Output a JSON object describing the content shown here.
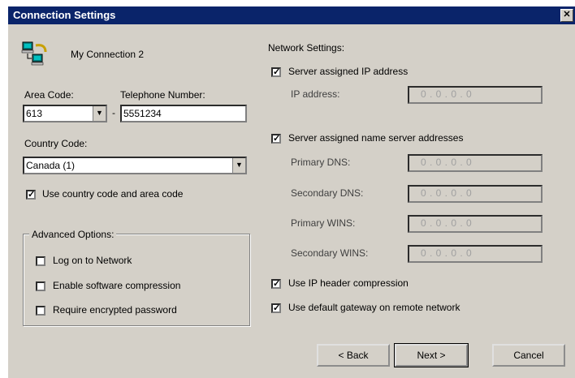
{
  "window": {
    "title": "Connection Settings",
    "close_glyph": "✕"
  },
  "connection": {
    "name": "My Connection 2",
    "icon": "network-connection-icon"
  },
  "area_code": {
    "label": "Area Code:",
    "value": "613"
  },
  "telephone": {
    "label": "Telephone Number:",
    "value": "5551234"
  },
  "dash": "-",
  "country_code": {
    "label": "Country Code:",
    "value": "Canada (1)"
  },
  "use_country_code": {
    "label": "Use country code and area code",
    "checked": true
  },
  "advanced": {
    "label": "Advanced Options:",
    "log_on": {
      "label": "Log on to Network",
      "checked": false
    },
    "software_compression": {
      "label": "Enable software compression",
      "checked": false
    },
    "encrypted_password": {
      "label": "Require encrypted password",
      "checked": false
    }
  },
  "network": {
    "label": "Network Settings:",
    "server_ip": {
      "label": "Server assigned IP address",
      "checked": true
    },
    "ip_address": {
      "label": "IP address:",
      "value": "0 . 0 . 0 . 0"
    },
    "server_dns": {
      "label": "Server assigned name server addresses",
      "checked": true
    },
    "primary_dns": {
      "label": "Primary DNS:",
      "value": "0 . 0 . 0 . 0"
    },
    "secondary_dns": {
      "label": "Secondary DNS:",
      "value": "0 . 0 . 0 . 0"
    },
    "primary_wins": {
      "label": "Primary WINS:",
      "value": "0 . 0 . 0 . 0"
    },
    "secondary_wins": {
      "label": "Secondary WINS:",
      "value": "0 . 0 . 0 . 0"
    },
    "ip_header": {
      "label": "Use IP header compression",
      "checked": true
    },
    "default_gateway": {
      "label": "Use default gateway on remote network",
      "checked": true
    }
  },
  "buttons": {
    "back": "< Back",
    "next": "Next >",
    "cancel": "Cancel"
  },
  "check_glyph": "✓",
  "dropdown_glyph": "▼"
}
